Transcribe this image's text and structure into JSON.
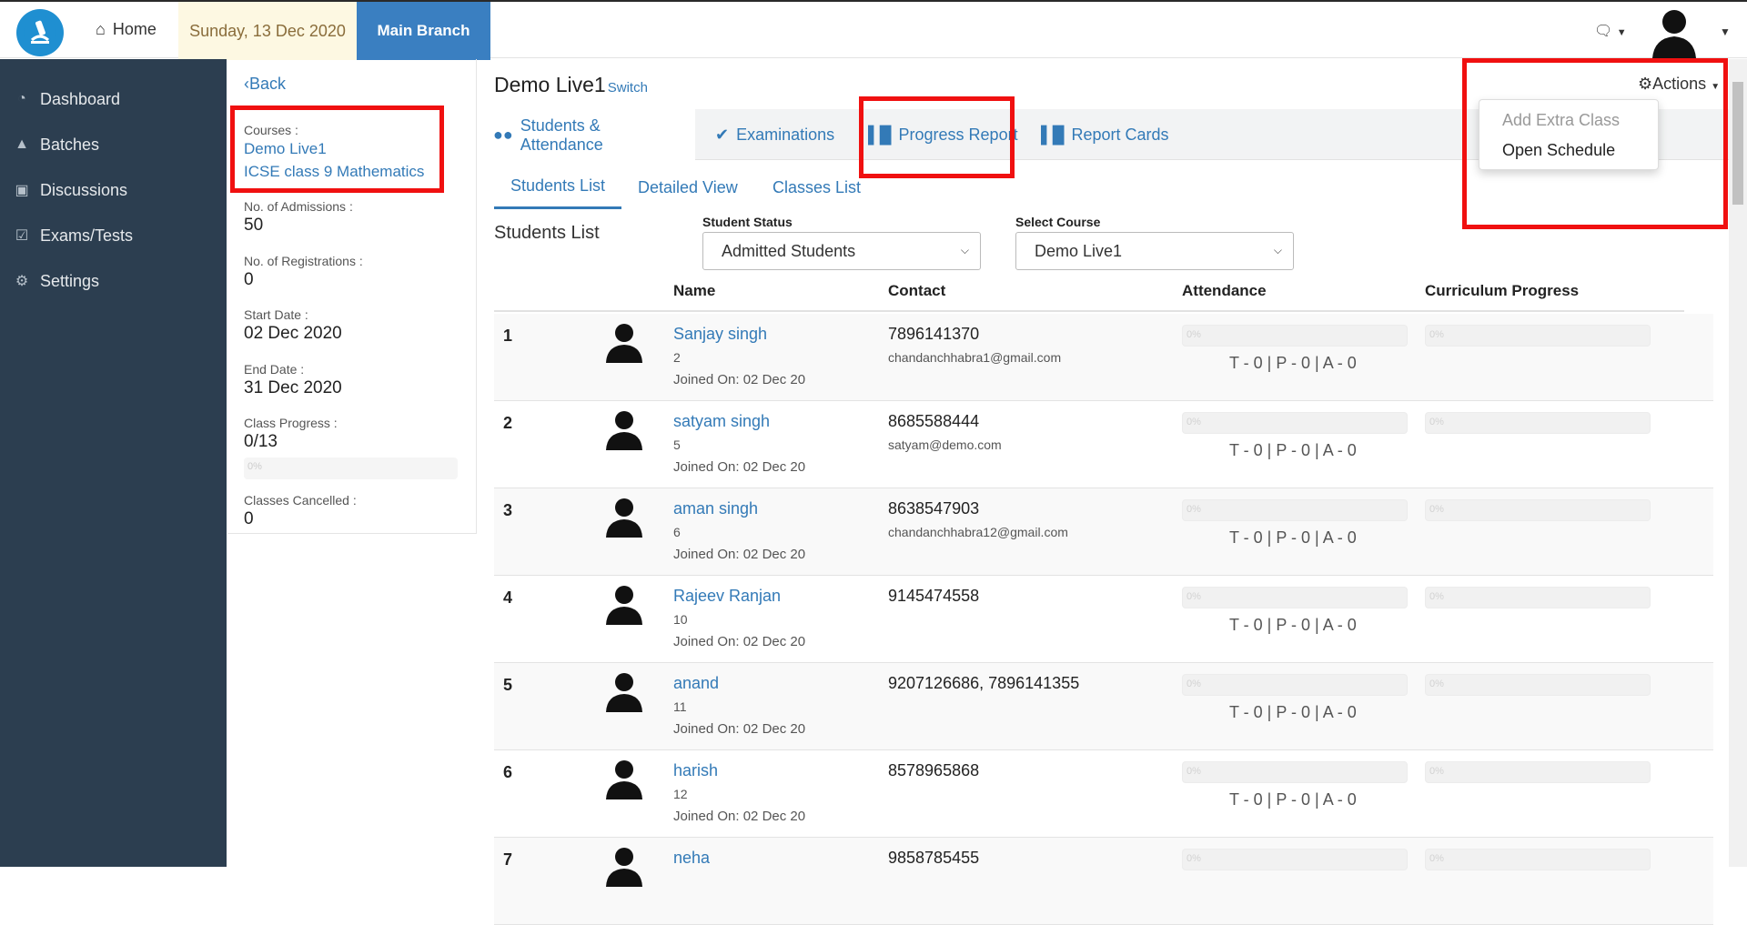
{
  "topbar": {
    "home_label": "Home",
    "date": "Sunday, 13 Dec 2020",
    "branch": "Main Branch"
  },
  "sidebar": {
    "items": [
      {
        "label": "Dashboard",
        "icon": "dashboard-icon"
      },
      {
        "label": "Batches",
        "icon": "graduation-cap-icon"
      },
      {
        "label": "Discussions",
        "icon": "comments-icon"
      },
      {
        "label": "Exams/Tests",
        "icon": "check-square-icon"
      },
      {
        "label": "Settings",
        "icon": "gear-icon"
      }
    ]
  },
  "course_info": {
    "back_label": "Back",
    "courses_label": "Courses :",
    "courses": [
      "Demo Live1",
      "ICSE class 9 Mathematics"
    ],
    "admissions_label": "No. of Admissions :",
    "admissions": "50",
    "registrations_label": "No. of Registrations :",
    "registrations": "0",
    "start_label": "Start Date :",
    "start_date": "02 Dec 2020",
    "end_label": "End Date :",
    "end_date": "31 Dec 2020",
    "progress_label": "Class Progress :",
    "progress_value": "0/13",
    "progress_bar_text": "0%",
    "cancelled_label": "Classes Cancelled :",
    "cancelled": "0"
  },
  "main": {
    "title": "Demo Live1",
    "switch_label": "Switch",
    "actions_label": "Actions",
    "actions_menu": [
      "Add Extra Class",
      "Open Schedule"
    ],
    "tabs": [
      "Students & Attendance",
      "Examinations",
      "Progress Report",
      "Report Cards"
    ],
    "subtabs": [
      "Students List",
      "Detailed View",
      "Classes List"
    ],
    "list_title": "Students List",
    "status_filter_label": "Student Status",
    "status_filter_value": "Admitted Students",
    "course_filter_label": "Select Course",
    "course_filter_value": "Demo Live1",
    "columns": [
      "Name",
      "Contact",
      "Attendance",
      "Curriculum Progress"
    ]
  },
  "students": [
    {
      "num": "1",
      "name": "Sanjay singh",
      "id": "2",
      "joined": "Joined On: 02 Dec 20",
      "phone": "7896141370",
      "email": "chandanchhabra1@gmail.com",
      "attendance_bar": "0%",
      "progress_bar": "0%",
      "attendance": "T - 0 | P - 0 | A - 0"
    },
    {
      "num": "2",
      "name": "satyam singh",
      "id": "5",
      "joined": "Joined On: 02 Dec 20",
      "phone": "8685588444",
      "email": "satyam@demo.com",
      "attendance_bar": "0%",
      "progress_bar": "0%",
      "attendance": "T - 0 | P - 0 | A - 0"
    },
    {
      "num": "3",
      "name": "aman singh",
      "id": "6",
      "joined": "Joined On: 02 Dec 20",
      "phone": "8638547903",
      "email": "chandanchhabra12@gmail.com",
      "attendance_bar": "0%",
      "progress_bar": "0%",
      "attendance": "T - 0 | P - 0 | A - 0"
    },
    {
      "num": "4",
      "name": "Rajeev Ranjan",
      "id": "10",
      "joined": "Joined On: 02 Dec 20",
      "phone": "9145474558",
      "email": "",
      "attendance_bar": "0%",
      "progress_bar": "0%",
      "attendance": "T - 0 | P - 0 | A - 0"
    },
    {
      "num": "5",
      "name": "anand",
      "id": "11",
      "joined": "Joined On: 02 Dec 20",
      "phone": "9207126686, 7896141355",
      "email": "",
      "attendance_bar": "0%",
      "progress_bar": "0%",
      "attendance": "T - 0 | P - 0 | A - 0"
    },
    {
      "num": "6",
      "name": "harish",
      "id": "12",
      "joined": "Joined On: 02 Dec 20",
      "phone": "8578965868",
      "email": "",
      "attendance_bar": "0%",
      "progress_bar": "0%",
      "attendance": "T - 0 | P - 0 | A - 0"
    },
    {
      "num": "7",
      "name": "neha",
      "id": "",
      "joined": "",
      "phone": "9858785455",
      "email": "",
      "attendance_bar": "0%",
      "progress_bar": "0%",
      "attendance": ""
    }
  ],
  "colors": {
    "sidebar_bg": "#2c3e50",
    "branch_bg": "#3a7fc1",
    "date_bg": "#fdf8e2",
    "link": "#337ab7",
    "highlight": "#f01010"
  }
}
